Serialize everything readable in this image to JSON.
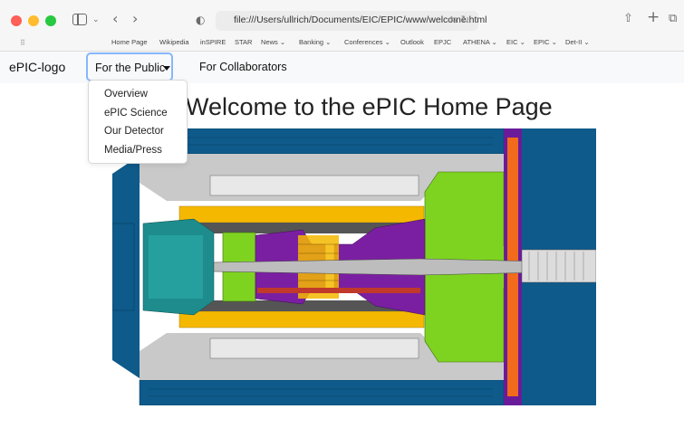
{
  "browser": {
    "url": "file:///Users/ullrich/Documents/EIC/EPIC/www/welcome.html",
    "bookmarks": [
      "Home Page",
      "Wikipedia",
      "inSPIRE",
      "STAR",
      "News ⌄",
      "Banking ⌄",
      "Conferences ⌄",
      "Outlook",
      "EPJC",
      "ATHENA ⌄",
      "EIC ⌄",
      "EPIC ⌄",
      "Det-II ⌄"
    ]
  },
  "navbar": {
    "brand": "ePIC-logo",
    "public_label": "For the Public",
    "collab_label": "For Collaborators"
  },
  "dropdown": {
    "items": [
      "Overview",
      "ePIC Science",
      "Our Detector",
      "Media/Press"
    ]
  },
  "main": {
    "title": "Welcome to the ePIC Home Page"
  },
  "colors": {
    "accent_focus": "#86b7fe",
    "detector_blue": "#0e5a8a",
    "detector_green": "#7ed321",
    "detector_purple": "#7b1fa2",
    "detector_orange": "#f5b800"
  }
}
